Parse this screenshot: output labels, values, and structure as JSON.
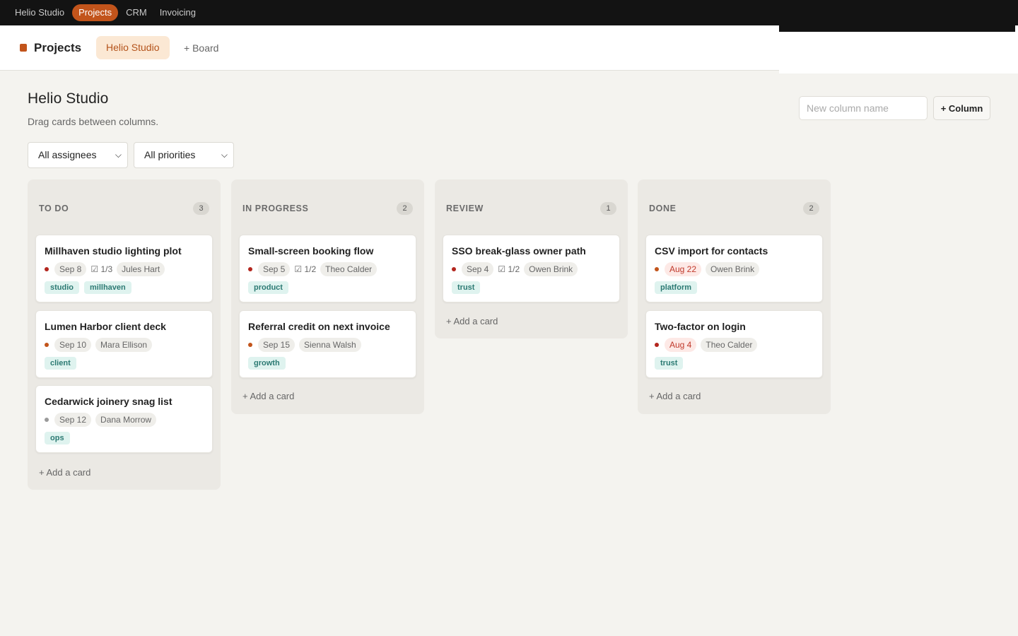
{
  "topbar": {
    "tabs": [
      {
        "label": "Helio Studio",
        "active": false
      },
      {
        "label": "Projects",
        "active": true
      },
      {
        "label": "CRM",
        "active": false
      },
      {
        "label": "Invoicing",
        "active": false
      }
    ]
  },
  "header": {
    "title": "Projects",
    "board_pill": "Helio Studio",
    "add_board": "+ Board"
  },
  "page": {
    "title": "Helio Studio",
    "subtitle": "Drag cards between columns.",
    "new_column_placeholder": "New column name",
    "add_column_label": "+ Column"
  },
  "filters": {
    "assignee": "All assignees",
    "priority": "All priorities"
  },
  "colors": {
    "accent": "#c2541b",
    "priority_high": "#b3261e",
    "priority_medium": "#c2541b",
    "priority_low": "#9a9a9a"
  },
  "columns": [
    {
      "name": "TO DO",
      "count": "3",
      "add_label": "+ Add a card",
      "cards": [
        {
          "title": "Millhaven studio lighting plot",
          "priority": "high",
          "due": "Sep 8",
          "subtasks": "☑ 1/3",
          "assignee": "Jules Hart",
          "tags": [
            "studio",
            "millhaven"
          ]
        },
        {
          "title": "Lumen Harbor client deck",
          "priority": "medium",
          "due": "Sep 10",
          "assignee": "Mara Ellison",
          "tags": [
            "client"
          ]
        },
        {
          "title": "Cedarwick joinery snag list",
          "priority": "low",
          "due": "Sep 12",
          "assignee": "Dana Morrow",
          "tags": [
            "ops"
          ]
        }
      ]
    },
    {
      "name": "IN PROGRESS",
      "count": "2",
      "add_label": "+ Add a card",
      "cards": [
        {
          "title": "Small-screen booking flow",
          "priority": "high",
          "due": "Sep 5",
          "subtasks": "☑ 1/2",
          "assignee": "Theo Calder",
          "tags": [
            "product"
          ]
        },
        {
          "title": "Referral credit on next invoice",
          "priority": "medium",
          "due": "Sep 15",
          "assignee": "Sienna Walsh",
          "tags": [
            "growth"
          ]
        }
      ]
    },
    {
      "name": "REVIEW",
      "count": "1",
      "add_label": "+ Add a card",
      "cards": [
        {
          "title": "SSO break-glass owner path",
          "priority": "high",
          "due": "Sep 4",
          "subtasks": "☑ 1/2",
          "assignee": "Owen Brink",
          "tags": [
            "trust"
          ]
        }
      ]
    },
    {
      "name": "DONE",
      "count": "2",
      "add_label": "+ Add a card",
      "cards": [
        {
          "title": "CSV import for contacts",
          "priority": "medium",
          "due": "Aug 22",
          "overdue": true,
          "assignee": "Owen Brink",
          "tags": [
            "platform"
          ]
        },
        {
          "title": "Two-factor on login",
          "priority": "high",
          "due": "Aug 4",
          "overdue": true,
          "assignee": "Theo Calder",
          "tags": [
            "trust"
          ]
        }
      ]
    }
  ]
}
